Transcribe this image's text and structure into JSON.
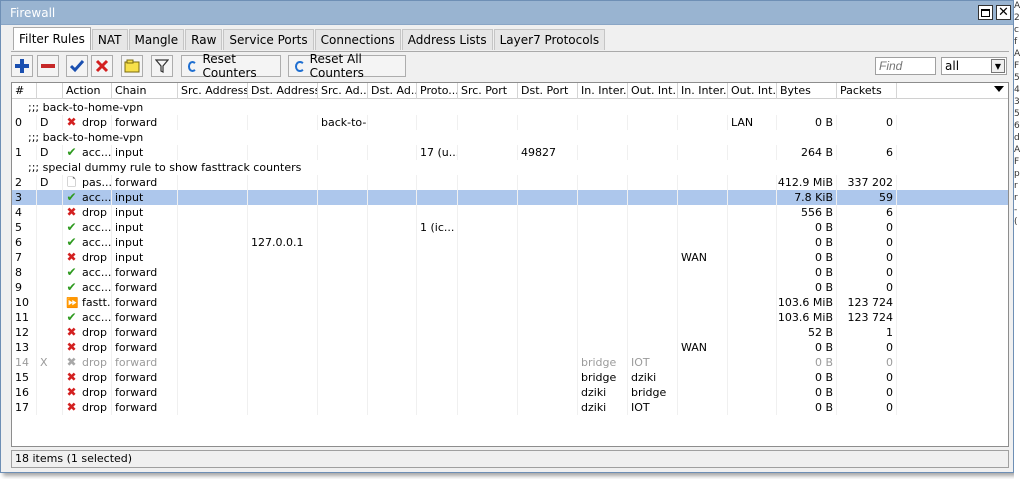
{
  "window": {
    "title": "Firewall"
  },
  "tabs": [
    "Filter Rules",
    "NAT",
    "Mangle",
    "Raw",
    "Service Ports",
    "Connections",
    "Address Lists",
    "Layer7 Protocols"
  ],
  "toolbar": {
    "reset_counters": "Reset Counters",
    "reset_all_counters": "Reset All Counters",
    "find_placeholder": "Find",
    "filter_value": "all"
  },
  "columns": [
    "#",
    "",
    "Action",
    "Chain",
    "Src. Address",
    "Dst. Address",
    "Src. Ad...",
    "Dst. Ad...",
    "Proto...",
    "Src. Port",
    "Dst. Port",
    "In. Inter...",
    "Out. Int...",
    "In. Inter...",
    "Out. Int...",
    "Bytes",
    "Packets"
  ],
  "rows": [
    {
      "type": "comment",
      "text": ";;; back-to-home-vpn"
    },
    {
      "type": "rule",
      "num": "0",
      "flag": "D",
      "action": "drop",
      "action_label": "drop",
      "chain": "forward",
      "src_addr_list": "back-to-...",
      "out_iface_list": "LAN",
      "bytes": "0 B",
      "packets": "0"
    },
    {
      "type": "comment",
      "text": ";;; back-to-home-vpn"
    },
    {
      "type": "rule",
      "num": "1",
      "flag": "D",
      "action": "accept",
      "action_label": "acc...",
      "chain": "input",
      "protocol": "17 (u...",
      "dst_port": "49827",
      "bytes": "264 B",
      "packets": "6"
    },
    {
      "type": "comment",
      "text": ";;; special dummy rule to show fasttrack counters"
    },
    {
      "type": "rule",
      "num": "2",
      "flag": "D",
      "action": "passthrough",
      "action_label": "pas...",
      "chain": "forward",
      "bytes": "412.9 MiB",
      "packets": "337 202"
    },
    {
      "type": "rule",
      "num": "3",
      "flag": "",
      "action": "accept",
      "action_label": "acc...",
      "chain": "input",
      "bytes": "7.8 KiB",
      "packets": "59",
      "selected": true
    },
    {
      "type": "rule",
      "num": "4",
      "flag": "",
      "action": "drop",
      "action_label": "drop",
      "chain": "input",
      "bytes": "556 B",
      "packets": "6"
    },
    {
      "type": "rule",
      "num": "5",
      "flag": "",
      "action": "accept",
      "action_label": "acc...",
      "chain": "input",
      "protocol": "1 (ic...",
      "bytes": "0 B",
      "packets": "0"
    },
    {
      "type": "rule",
      "num": "6",
      "flag": "",
      "action": "accept",
      "action_label": "acc...",
      "chain": "input",
      "dst_address": "127.0.0.1",
      "bytes": "0 B",
      "packets": "0"
    },
    {
      "type": "rule",
      "num": "7",
      "flag": "",
      "action": "drop",
      "action_label": "drop",
      "chain": "input",
      "in_iface_list": "WAN",
      "bytes": "0 B",
      "packets": "0"
    },
    {
      "type": "rule",
      "num": "8",
      "flag": "",
      "action": "accept",
      "action_label": "acc...",
      "chain": "forward",
      "bytes": "0 B",
      "packets": "0"
    },
    {
      "type": "rule",
      "num": "9",
      "flag": "",
      "action": "accept",
      "action_label": "acc...",
      "chain": "forward",
      "bytes": "0 B",
      "packets": "0"
    },
    {
      "type": "rule",
      "num": "10",
      "flag": "",
      "action": "fasttrack",
      "action_label": "fastt...",
      "chain": "forward",
      "bytes": "103.6 MiB",
      "packets": "123 724"
    },
    {
      "type": "rule",
      "num": "11",
      "flag": "",
      "action": "accept",
      "action_label": "acc...",
      "chain": "forward",
      "bytes": "103.6 MiB",
      "packets": "123 724"
    },
    {
      "type": "rule",
      "num": "12",
      "flag": "",
      "action": "drop",
      "action_label": "drop",
      "chain": "forward",
      "bytes": "52 B",
      "packets": "1"
    },
    {
      "type": "rule",
      "num": "13",
      "flag": "",
      "action": "drop",
      "action_label": "drop",
      "chain": "forward",
      "in_iface_list": "WAN",
      "bytes": "0 B",
      "packets": "0"
    },
    {
      "type": "rule",
      "num": "14",
      "flag": "X",
      "action": "drop",
      "action_label": "drop",
      "chain": "forward",
      "in_iface": "bridge",
      "out_iface": "IOT",
      "bytes": "0 B",
      "packets": "0",
      "disabled": true
    },
    {
      "type": "rule",
      "num": "15",
      "flag": "",
      "action": "drop",
      "action_label": "drop",
      "chain": "forward",
      "in_iface": "bridge",
      "out_iface": "dziki",
      "bytes": "0 B",
      "packets": "0"
    },
    {
      "type": "rule",
      "num": "16",
      "flag": "",
      "action": "drop",
      "action_label": "drop",
      "chain": "forward",
      "in_iface": "dziki",
      "out_iface": "bridge",
      "bytes": "0 B",
      "packets": "0"
    },
    {
      "type": "rule",
      "num": "17",
      "flag": "",
      "action": "drop",
      "action_label": "drop",
      "chain": "forward",
      "in_iface": "dziki",
      "out_iface": "IOT",
      "bytes": "0 B",
      "packets": "0"
    }
  ],
  "status": {
    "text": "18 items (1 selected)"
  },
  "side_fragment": [
    "A",
    "2",
    "c",
    "f",
    "A",
    "F",
    "5",
    "4(",
    "3(",
    "5(",
    "6(",
    "d",
    "A",
    "F",
    "p",
    "r",
    "r",
    "-("
  ],
  "colors": {
    "title_bar": "#99b4d1",
    "selected_row": "#adc7ec",
    "accept": "#2e9a1f",
    "drop": "#d32020",
    "fasttrack": "#1f6fd1"
  }
}
